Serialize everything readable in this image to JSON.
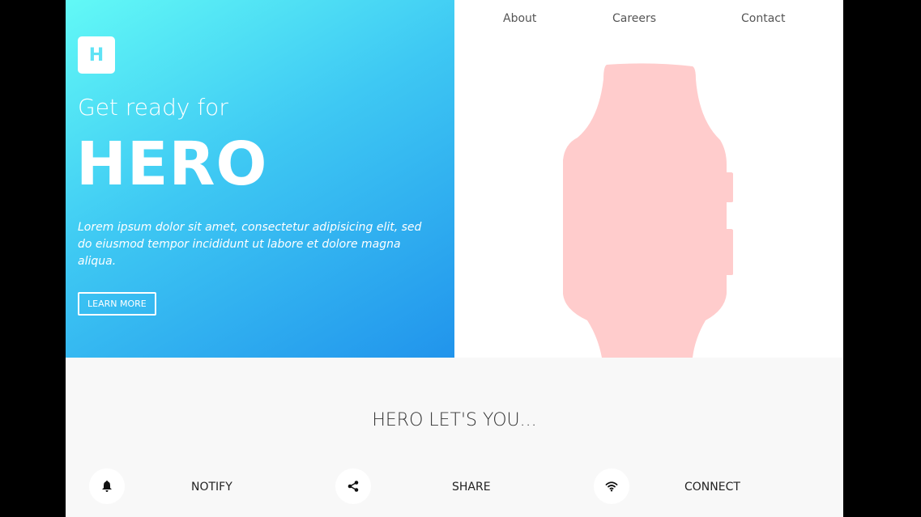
{
  "logo": {
    "letter": "H"
  },
  "hero": {
    "tagline": "Get ready for",
    "title": "HERO",
    "description": "Lorem ipsum dolor sit amet, consectetur adipisicing elit, sed do eiusmod tempor incididunt ut labore et dolore magna aliqua.",
    "button_label": "LEARN MORE"
  },
  "nav": {
    "items": [
      {
        "label": "About"
      },
      {
        "label": "Careers"
      },
      {
        "label": "Contact"
      }
    ]
  },
  "features": {
    "title": "HERO LET'S YOU...",
    "items": [
      {
        "label": "NOTIFY",
        "icon": "bell-icon"
      },
      {
        "label": "SHARE",
        "icon": "share-icon"
      },
      {
        "label": "CONNECT",
        "icon": "wifi-icon"
      }
    ]
  },
  "colors": {
    "gradient_start": "#62f9f6",
    "gradient_end": "#2194ec",
    "watch": "#ffcccc",
    "features_bg": "#f8f8f8"
  }
}
